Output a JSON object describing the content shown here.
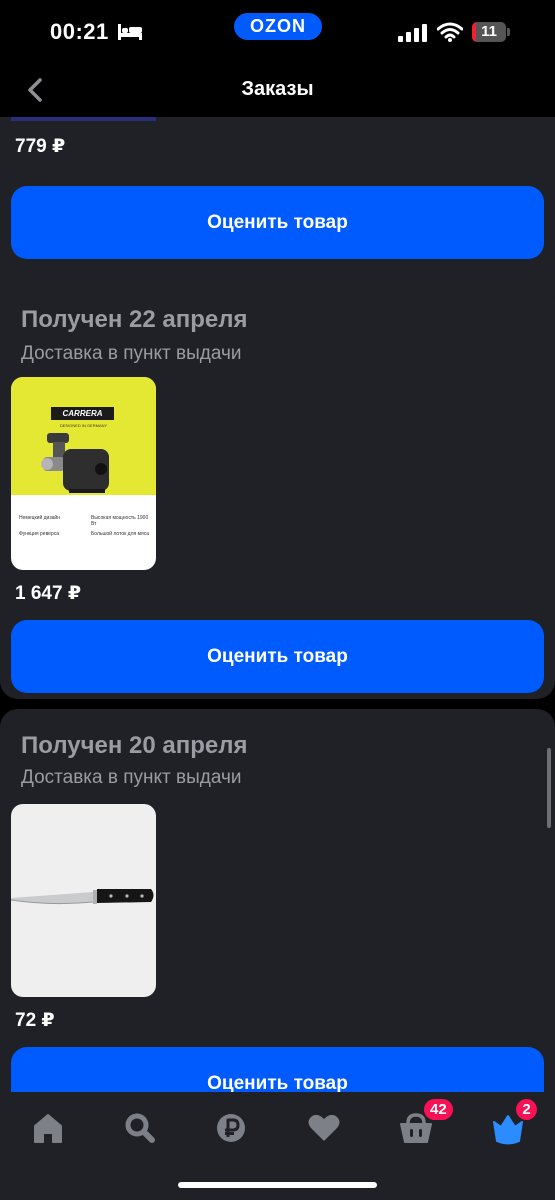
{
  "status_bar": {
    "time": "00:21",
    "brand": "OZON",
    "battery_level": "11",
    "battery_fraction": 0.11
  },
  "header": {
    "title": "Заказы"
  },
  "orders": [
    {
      "price": "779 ₽",
      "rate_label": "Оценить товар"
    },
    {
      "status": "Получен 22 апреля",
      "delivery": "Доставка в пункт выдачи",
      "product_image": {
        "brand": "CARRERA",
        "tagline": "DESIGNED IN GERMANY",
        "features": [
          "Немецкий дизайн",
          "Высокая мощность 1900 Вт",
          "Функция реверса",
          "Большой лоток для мяса"
        ]
      },
      "price": "1 647 ₽",
      "rate_label": "Оценить товар"
    },
    {
      "status": "Получен 20 апреля",
      "delivery": "Доставка в пункт выдачи",
      "price": "72 ₽",
      "rate_label": "Оценить товар"
    }
  ],
  "bottom_nav": {
    "items": [
      {
        "icon": "home-icon"
      },
      {
        "icon": "search-icon"
      },
      {
        "icon": "ruble-icon"
      },
      {
        "icon": "heart-icon"
      },
      {
        "icon": "basket-icon",
        "badge": "42"
      },
      {
        "icon": "crown-icon",
        "badge": "2"
      }
    ]
  },
  "colors": {
    "accent": "#005bff",
    "badge": "#f91155",
    "card_bg": "#1f2126",
    "muted_text": "#9a9ca3"
  }
}
